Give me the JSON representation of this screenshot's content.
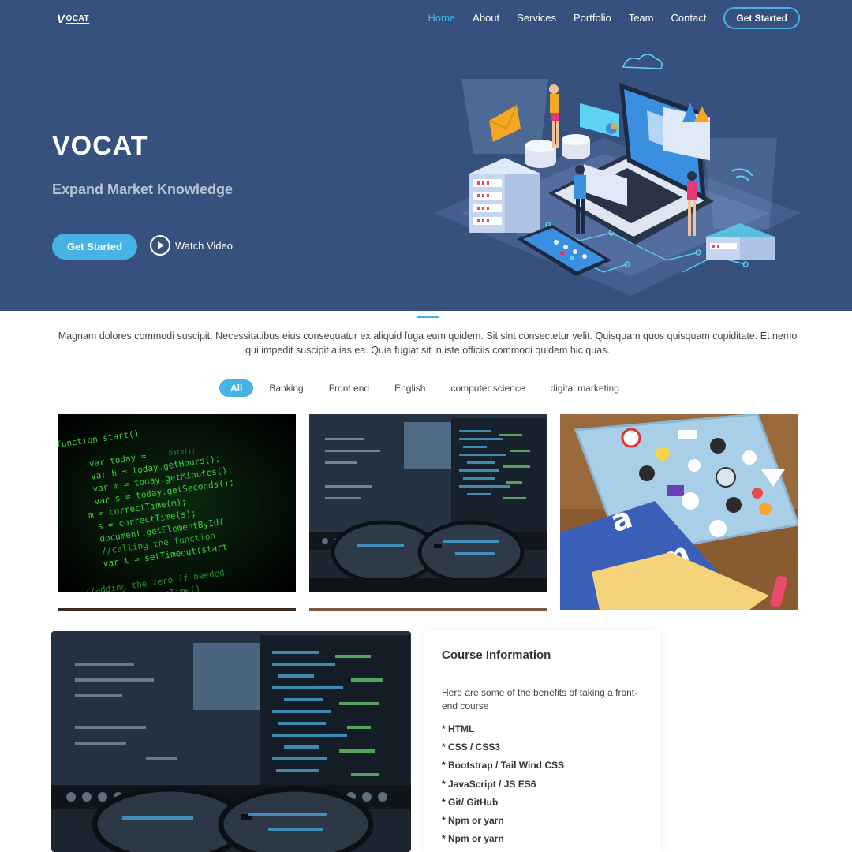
{
  "brand": {
    "logo_first": "V",
    "logo_rest": "OCAT"
  },
  "nav": {
    "items": [
      {
        "label": "Home",
        "active": true
      },
      {
        "label": "About"
      },
      {
        "label": "Services"
      },
      {
        "label": "Portfolio"
      },
      {
        "label": "Team"
      },
      {
        "label": "Contact"
      }
    ],
    "cta_label": "Get Started"
  },
  "hero": {
    "title": "VOCAT",
    "subtitle": "Expand Market Knowledge",
    "primary_button": "Get Started",
    "video_link": "Watch Video"
  },
  "intro": {
    "text": "Magnam dolores commodi suscipit. Necessitatibus eius consequatur ex aliquid fuga eum quidem. Sit sint consectetur velit. Quisquam quos quisquam cupiditate. Et nemo qui impedit suscipit alias ea. Quia fugiat sit in iste officiis commodi quidem hic quas."
  },
  "filters": [
    "All",
    "Banking",
    "Front end",
    "English",
    "computer science",
    "digital marketing"
  ],
  "code_tile": {
    "lines": [
      "function start()",
      "var today =",
      "Date();",
      "var h = today.getHours();",
      "var m = today.getMinutes();",
      "var s = today.getSeconds();",
      "m = correctTime(m);",
      "s = correctTime(s);",
      "document.getElementById(",
      "//calling the function",
      "var t = setTimeout(start",
      "//adding the zero if needed",
      "function correctTime()"
    ]
  },
  "course": {
    "title": "Course Information",
    "description": "Here are some of the benefits of taking a front-end course",
    "items": [
      "* HTML",
      "* CSS / CSS3",
      "* Bootstrap / Tail Wind CSS",
      "* JavaScript / JS ES6",
      "* Git/ GitHub",
      "* Npm or yarn",
      "* Npm or yarn"
    ]
  },
  "colors": {
    "hero_bg": "#37517e",
    "accent": "#47b2e4"
  }
}
